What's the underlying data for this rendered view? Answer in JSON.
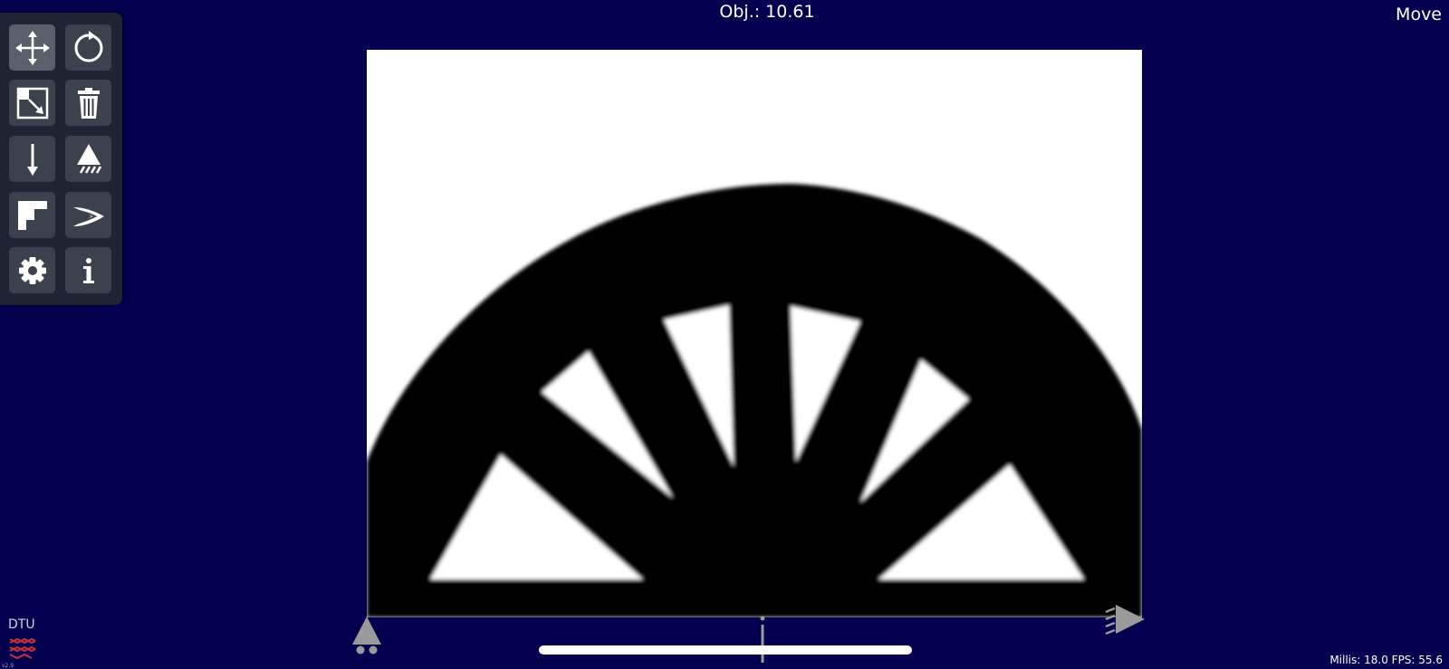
{
  "header": {
    "objective": "Obj.: 10.61",
    "mode": "Move"
  },
  "footer": {
    "stats": "Millis: 18.0 FPS: 55.6",
    "logo_text": "DTU",
    "version": "v2.9"
  },
  "toolbar": {
    "tools": [
      {
        "name": "move",
        "icon": "move-icon",
        "active": true
      },
      {
        "name": "rotate",
        "icon": "rotate-icon",
        "active": false
      },
      {
        "name": "resize",
        "icon": "resize-icon",
        "active": false
      },
      {
        "name": "delete",
        "icon": "trash-icon",
        "active": false
      },
      {
        "name": "load",
        "icon": "load-arrow-icon",
        "active": false
      },
      {
        "name": "support",
        "icon": "support-icon",
        "active": false
      },
      {
        "name": "passive",
        "icon": "passive-region-icon",
        "active": false
      },
      {
        "name": "optimize",
        "icon": "optimize-icon",
        "active": false
      },
      {
        "name": "settings",
        "icon": "gear-icon",
        "active": false
      },
      {
        "name": "info",
        "icon": "info-icon",
        "active": false
      }
    ]
  },
  "colors": {
    "background": "#03004f",
    "toolbar": "#1f2433",
    "tool_button": "#3b414d",
    "tool_button_active": "#59606b",
    "material": "#000000",
    "void": "#ffffff",
    "marker": "#9a9a9a"
  }
}
